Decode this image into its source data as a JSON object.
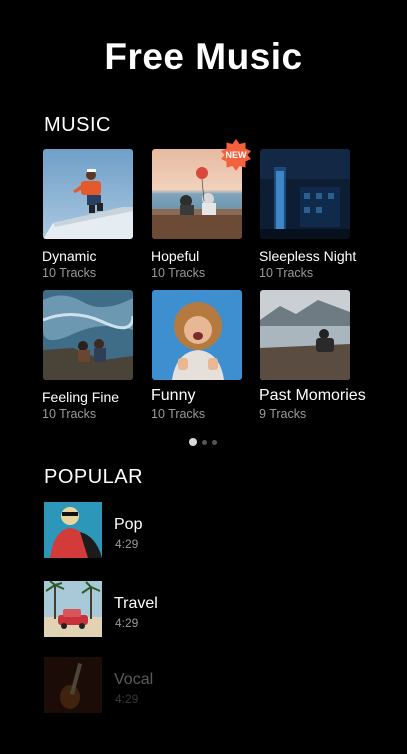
{
  "header": {
    "title": "Free Music"
  },
  "music_section": {
    "title": "MUSIC",
    "cards": [
      {
        "title": "Dynamic",
        "subtitle": "10 Tracks"
      },
      {
        "title": "Hopeful",
        "subtitle": "10 Tracks",
        "badge": "NEW"
      },
      {
        "title": "Sleepless Night",
        "subtitle": "10 Tracks"
      },
      {
        "title": "Feeling Fine",
        "subtitle": "10 Tracks"
      },
      {
        "title": "Funny",
        "subtitle": "10 Tracks"
      },
      {
        "title": "Past Momories",
        "subtitle": "9 Tracks"
      }
    ],
    "pager": {
      "pages": 3,
      "current": 1
    }
  },
  "popular_section": {
    "title": "POPULAR",
    "items": [
      {
        "title": "Pop",
        "duration": "4:29"
      },
      {
        "title": "Travel",
        "duration": "4:29"
      },
      {
        "title": "Vocal",
        "duration": "4:29"
      }
    ]
  },
  "colors": {
    "background": "#000000",
    "text": "#ffffff",
    "muted": "#9a9a9a",
    "badge": "#f5603d"
  }
}
